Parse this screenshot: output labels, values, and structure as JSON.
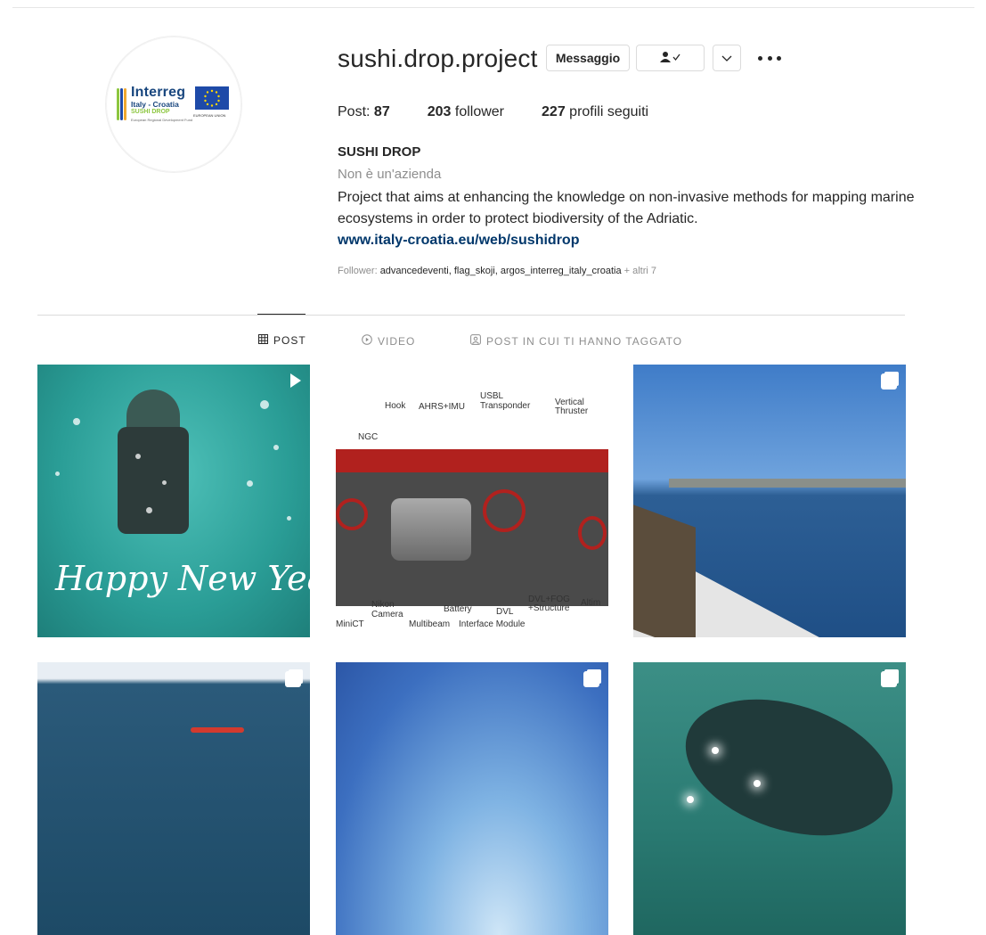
{
  "profile": {
    "username": "sushi.drop.project",
    "avatar_logo": {
      "brand": "Interreg",
      "subtitle": "Italy - Croatia",
      "project": "SUSHI DROP",
      "fund_text": "European Regional Development Fund",
      "eu_text": "EUROPEAN UNION"
    },
    "buttons": {
      "message": "Messaggio",
      "follow_icon": "person-check-icon",
      "dropdown_icon": "chevron-down-icon",
      "more_icon": "more-dots-icon"
    },
    "stats": {
      "posts_label": "Post:",
      "posts_count": "87",
      "followers_count": "203",
      "followers_label": "follower",
      "following_count": "227",
      "following_label": "profili seguiti"
    },
    "bio": {
      "name": "SUSHI DROP",
      "category": "Non è un'azienda",
      "text": "Project that aims at enhancing the knowledge on non-invasive methods for mapping marine ecosystems in order to protect biodiversity of the Adriatic.",
      "link": "www.italy-croatia.eu/web/sushidrop"
    },
    "followed_by": {
      "label": "Follower:",
      "names": "advancedeventi, flag_skoji, argos_interreg_italy_croatia",
      "more": "+ altri 7"
    }
  },
  "tabs": [
    {
      "label": "POST",
      "icon": "grid-icon",
      "active": true
    },
    {
      "label": "VIDEO",
      "icon": "video-icon",
      "active": false
    },
    {
      "label": "POST IN CUI TI HANNO TAGGATO",
      "icon": "tagged-icon",
      "active": false
    }
  ],
  "posts": [
    {
      "type": "video",
      "caption_text": "Happy New Year"
    },
    {
      "type": "image",
      "labels": [
        "Hook",
        "AHRS+IMU",
        "USBL",
        "Transponder",
        "Vertical",
        "Thruster",
        "NGC",
        "Nikon",
        "Camera",
        "MiniCT",
        "Multibeam",
        "Battery",
        "DVL",
        "Interface Module",
        "DVL+FOG",
        "+Structure",
        "Altim"
      ]
    },
    {
      "type": "carousel"
    },
    {
      "type": "carousel"
    },
    {
      "type": "carousel"
    },
    {
      "type": "carousel"
    }
  ],
  "colors": {
    "text": "#262626",
    "secondary": "#8e8e8e",
    "link": "#00376b",
    "border": "#dbdbdb"
  }
}
